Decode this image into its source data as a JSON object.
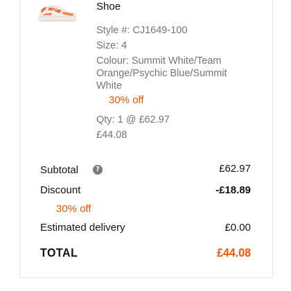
{
  "product": {
    "name": "Shoe",
    "style": "Style #: CJ1649-100",
    "size": "Size: 4",
    "colour": "Colour: Summit White/Team Orange/Psychic Blue/Summit White",
    "offer": "30% off",
    "qty": "Qty: 1 @ £62.97",
    "line_total": "£44.08",
    "thumbnail_icon": "shoe-thumbnail"
  },
  "summary": {
    "subtotal_label": "Subtotal",
    "subtotal_value": "£62.97",
    "info_icon": "?",
    "discount_label": "Discount",
    "discount_value": "-£18.89",
    "discount_offer": "30% off",
    "delivery_label": "Estimated delivery",
    "delivery_value": "£0.00",
    "total_label": "TOTAL",
    "total_value": "£44.08"
  },
  "colors": {
    "accent": "#fa5400",
    "muted_text": "#757575",
    "text": "#111111"
  }
}
